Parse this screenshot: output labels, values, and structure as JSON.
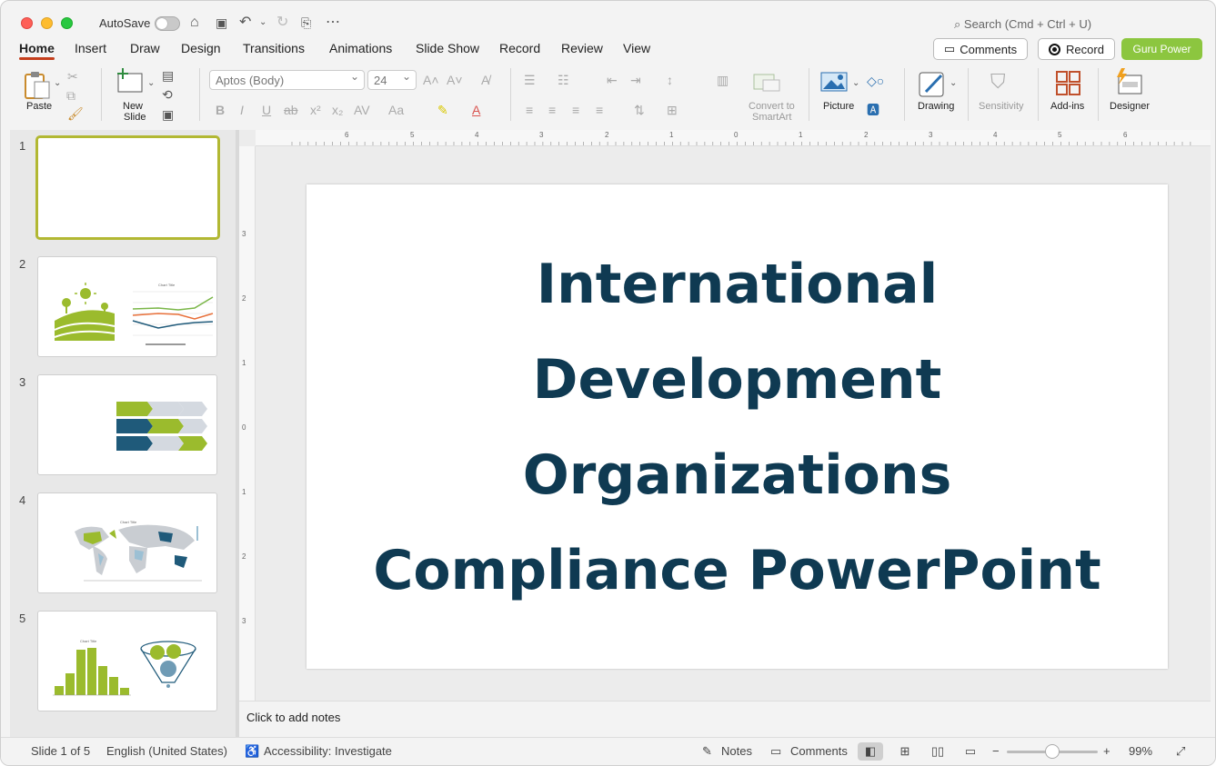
{
  "titlebar": {
    "autosave_label": "AutoSave",
    "search_placeholder": "Search (Cmd + Ctrl + U)"
  },
  "tabs": [
    "Home",
    "Insert",
    "Draw",
    "Design",
    "Transitions",
    "Animations",
    "Slide Show",
    "Record",
    "Review",
    "View"
  ],
  "actions": {
    "comments": "Comments",
    "record": "Record",
    "guru": "Guru Power"
  },
  "ribbon": {
    "paste": "Paste",
    "new_slide_line1": "New",
    "new_slide_line2": "Slide",
    "font_name": "Aptos (Body)",
    "font_size": "24",
    "convert_line1": "Convert to",
    "convert_line2": "SmartArt",
    "picture": "Picture",
    "drawing": "Drawing",
    "sensitivity": "Sensitivity",
    "addins": "Add-ins",
    "designer": "Designer"
  },
  "slides_panel": {
    "numbers": [
      "1",
      "2",
      "3",
      "4",
      "5"
    ],
    "thumb_chart_title": "Chart Title"
  },
  "ruler": {
    "h_labels": [
      "6",
      "5",
      "4",
      "3",
      "2",
      "1",
      "0",
      "1",
      "2",
      "3",
      "4",
      "5",
      "6"
    ],
    "v_labels": [
      "3",
      "2",
      "1",
      "0",
      "1",
      "2",
      "3"
    ]
  },
  "slide": {
    "title_lines": [
      "International",
      "Development",
      "Organizations",
      "Compliance PowerPoint"
    ]
  },
  "notes": {
    "placeholder": "Click to add notes"
  },
  "status": {
    "slide_count": "Slide 1 of 5",
    "language": "English (United States)",
    "accessibility": "Accessibility: Investigate",
    "notes_btn": "Notes",
    "comments_btn": "Comments",
    "zoom": "99%"
  },
  "colors": {
    "accent_tab": "#c43e1c",
    "guru_green": "#8cc63f",
    "title_navy": "#0f3a52",
    "thumb_green": "#9bbb2d",
    "thumb_blue": "#1f5a7a"
  }
}
